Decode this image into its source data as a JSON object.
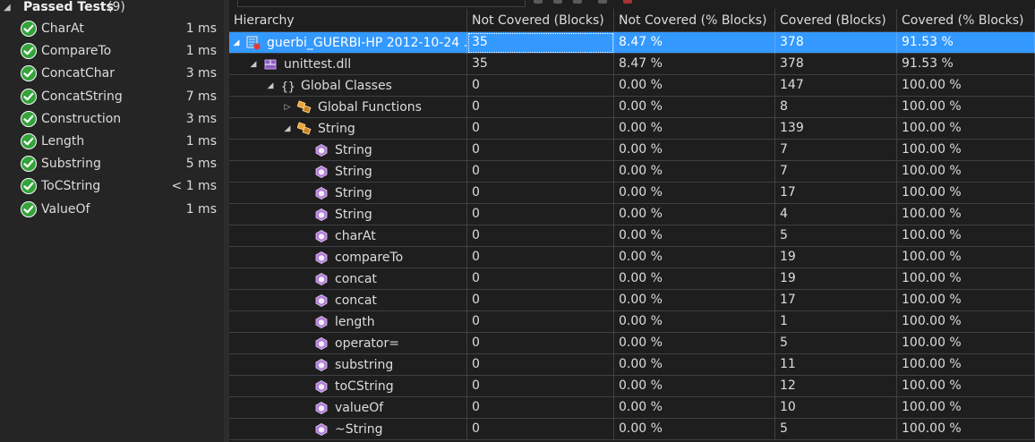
{
  "tests": {
    "header": {
      "title": "Passed Tests",
      "count": "(9)"
    },
    "items": [
      {
        "name": "CharAt",
        "duration": "1 ms"
      },
      {
        "name": "CompareTo",
        "duration": "1 ms"
      },
      {
        "name": "ConcatChar",
        "duration": "3 ms"
      },
      {
        "name": "ConcatString",
        "duration": "7 ms"
      },
      {
        "name": "Construction",
        "duration": "3 ms"
      },
      {
        "name": "Length",
        "duration": "1 ms"
      },
      {
        "name": "Substring",
        "duration": "5 ms"
      },
      {
        "name": "ToCString",
        "duration": "< 1 ms"
      },
      {
        "name": "ValueOf",
        "duration": "1 ms"
      }
    ],
    "colors": {
      "pass": "#33a33a"
    }
  },
  "coverage": {
    "columns": [
      "Hierarchy",
      "Not Covered (Blocks)",
      "Not Covered (% Blocks)",
      "Covered (Blocks)",
      "Covered (% Blocks)"
    ],
    "rows": [
      {
        "label": "guerbi_GUERBI-HP 2012-10-24 ...",
        "depth": 0,
        "expander": "expanded",
        "icon": "coverage-result-icon",
        "nc": "35",
        "ncp": "8.47 %",
        "c": "378",
        "cp": "91.53 %",
        "selected": true
      },
      {
        "label": "unittest.dll",
        "depth": 1,
        "expander": "expanded",
        "icon": "module-icon",
        "nc": "35",
        "ncp": "8.47 %",
        "c": "378",
        "cp": "91.53 %"
      },
      {
        "label": "Global Classes",
        "depth": 2,
        "expander": "expanded",
        "icon": "namespace-icon",
        "nc": "0",
        "ncp": "0.00 %",
        "c": "147",
        "cp": "100.00 %"
      },
      {
        "label": "Global Functions",
        "depth": 3,
        "expander": "collapsed",
        "icon": "class-icon",
        "nc": "0",
        "ncp": "0.00 %",
        "c": "8",
        "cp": "100.00 %"
      },
      {
        "label": "String",
        "depth": 3,
        "expander": "expanded",
        "icon": "class-icon",
        "nc": "0",
        "ncp": "0.00 %",
        "c": "139",
        "cp": "100.00 %"
      },
      {
        "label": "String",
        "depth": 4,
        "expander": "none",
        "icon": "method-icon",
        "nc": "0",
        "ncp": "0.00 %",
        "c": "7",
        "cp": "100.00 %"
      },
      {
        "label": "String",
        "depth": 4,
        "expander": "none",
        "icon": "method-icon",
        "nc": "0",
        "ncp": "0.00 %",
        "c": "7",
        "cp": "100.00 %"
      },
      {
        "label": "String",
        "depth": 4,
        "expander": "none",
        "icon": "method-icon",
        "nc": "0",
        "ncp": "0.00 %",
        "c": "17",
        "cp": "100.00 %"
      },
      {
        "label": "String",
        "depth": 4,
        "expander": "none",
        "icon": "method-icon",
        "nc": "0",
        "ncp": "0.00 %",
        "c": "4",
        "cp": "100.00 %"
      },
      {
        "label": "charAt",
        "depth": 4,
        "expander": "none",
        "icon": "method-icon",
        "nc": "0",
        "ncp": "0.00 %",
        "c": "5",
        "cp": "100.00 %"
      },
      {
        "label": "compareTo",
        "depth": 4,
        "expander": "none",
        "icon": "method-icon",
        "nc": "0",
        "ncp": "0.00 %",
        "c": "19",
        "cp": "100.00 %"
      },
      {
        "label": "concat",
        "depth": 4,
        "expander": "none",
        "icon": "method-icon",
        "nc": "0",
        "ncp": "0.00 %",
        "c": "19",
        "cp": "100.00 %"
      },
      {
        "label": "concat",
        "depth": 4,
        "expander": "none",
        "icon": "method-icon",
        "nc": "0",
        "ncp": "0.00 %",
        "c": "17",
        "cp": "100.00 %"
      },
      {
        "label": "length",
        "depth": 4,
        "expander": "none",
        "icon": "method-icon",
        "nc": "0",
        "ncp": "0.00 %",
        "c": "1",
        "cp": "100.00 %"
      },
      {
        "label": "operator=",
        "depth": 4,
        "expander": "none",
        "icon": "method-icon",
        "nc": "0",
        "ncp": "0.00 %",
        "c": "5",
        "cp": "100.00 %"
      },
      {
        "label": "substring",
        "depth": 4,
        "expander": "none",
        "icon": "method-icon",
        "nc": "0",
        "ncp": "0.00 %",
        "c": "11",
        "cp": "100.00 %"
      },
      {
        "label": "toCString",
        "depth": 4,
        "expander": "none",
        "icon": "method-icon",
        "nc": "0",
        "ncp": "0.00 %",
        "c": "12",
        "cp": "100.00 %"
      },
      {
        "label": "valueOf",
        "depth": 4,
        "expander": "none",
        "icon": "method-icon",
        "nc": "0",
        "ncp": "0.00 %",
        "c": "10",
        "cp": "100.00 %"
      },
      {
        "label": "~String",
        "depth": 4,
        "expander": "none",
        "icon": "method-icon",
        "nc": "0",
        "ncp": "0.00 %",
        "c": "5",
        "cp": "100.00 %"
      }
    ],
    "colors": {
      "selection": "#3399ff",
      "method": "#b180d7",
      "class": "#e8a33d",
      "module": "#c8a2e8"
    }
  }
}
